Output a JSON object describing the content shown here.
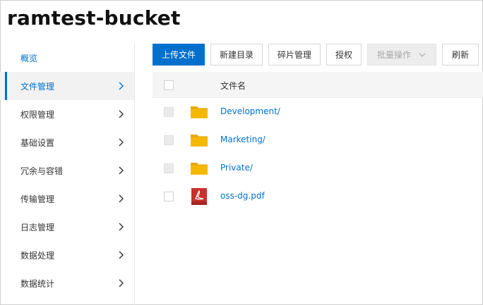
{
  "header": {
    "title": "ramtest-bucket"
  },
  "sidebar": {
    "items": [
      {
        "label": "概览"
      },
      {
        "label": "文件管理"
      },
      {
        "label": "权限管理"
      },
      {
        "label": "基础设置"
      },
      {
        "label": "冗余与容错"
      },
      {
        "label": "传输管理"
      },
      {
        "label": "日志管理"
      },
      {
        "label": "数据处理"
      },
      {
        "label": "数据统计"
      }
    ],
    "active_index": 1
  },
  "toolbar": {
    "upload_label": "上传文件",
    "new_dir_label": "新建目录",
    "fragment_label": "碎片管理",
    "authorize_label": "授权",
    "batch_label": "批量操作",
    "refresh_label": "刷新"
  },
  "table": {
    "header": {
      "name": "文件名"
    },
    "rows": [
      {
        "name": "Development/",
        "type": "folder"
      },
      {
        "name": "Marketing/",
        "type": "folder"
      },
      {
        "name": "Private/",
        "type": "folder"
      },
      {
        "name": "oss-dg.pdf",
        "type": "pdf"
      }
    ]
  },
  "colors": {
    "accent": "#0070cc",
    "folder": "#f5b800",
    "pdf": "#c9302c",
    "disabled_bg": "#ededed"
  }
}
